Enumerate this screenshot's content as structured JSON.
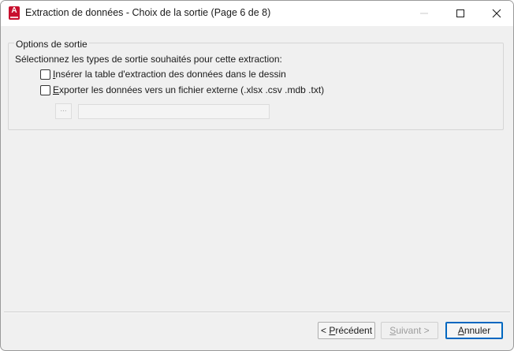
{
  "window": {
    "title": "Extraction de données - Choix de la sortie (Page 6 de 8)"
  },
  "app_icon": {
    "letter": "A"
  },
  "group": {
    "legend": "Options de sortie",
    "instruction": "Sélectionnez les types de sortie souhaités pour cette extraction:",
    "option1": {
      "pre": "",
      "mnemonic": "I",
      "post": "nsérer la table d'extraction des données dans le dessin",
      "checked": false
    },
    "option2": {
      "pre": "",
      "mnemonic": "E",
      "post": "xporter les données vers un fichier externe (.xlsx .csv .mdb .txt)",
      "checked": false
    },
    "browse_label": "...",
    "path_value": ""
  },
  "buttons": {
    "prev": {
      "pre": "< ",
      "mnemonic": "P",
      "post": "récédent"
    },
    "next": {
      "pre": "",
      "mnemonic": "S",
      "post": "uivant >"
    },
    "cancel": {
      "pre": "",
      "mnemonic": "A",
      "post": "nnuler"
    }
  }
}
